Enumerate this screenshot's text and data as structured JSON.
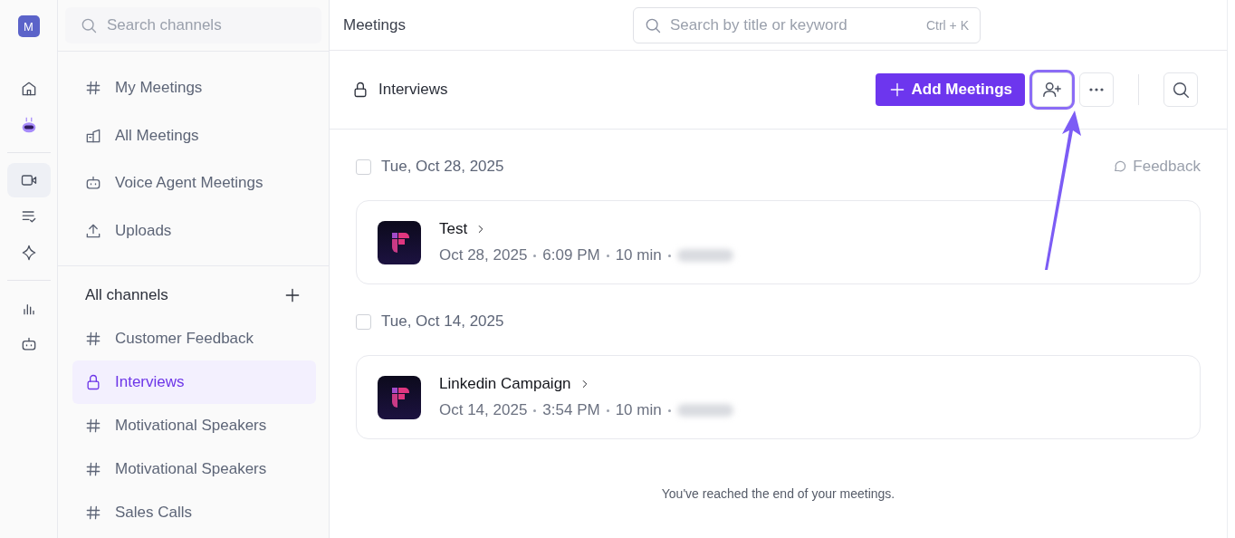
{
  "rail": {
    "avatar": "M",
    "items": [
      {
        "selected": false
      },
      {
        "selected": false
      },
      {
        "selected": true
      },
      {
        "selected": false
      },
      {
        "selected": false
      },
      {
        "selected": false
      },
      {
        "selected": false
      }
    ]
  },
  "sidebar": {
    "search": {
      "placeholder": "Search channels"
    },
    "nav": [
      {
        "label": "My Meetings"
      },
      {
        "label": "All Meetings"
      },
      {
        "label": "Voice Agent Meetings"
      },
      {
        "label": "Uploads"
      }
    ],
    "channels_title": "All channels",
    "channels": [
      {
        "label": "Customer Feedback",
        "private": false,
        "selected": false
      },
      {
        "label": "Interviews",
        "private": true,
        "selected": true
      },
      {
        "label": "Motivational Speakers",
        "private": false,
        "selected": false
      },
      {
        "label": "Motivational Speakers",
        "private": false,
        "selected": false
      },
      {
        "label": "Sales Calls",
        "private": false,
        "selected": false
      }
    ]
  },
  "topbar": {
    "title": "Meetings",
    "search": {
      "placeholder": "Search by title or keyword",
      "shortcut": "Ctrl + K"
    }
  },
  "header": {
    "title": "Interviews",
    "private": true,
    "add_button": "Add Meetings",
    "invite_highlighted": true
  },
  "groups": [
    {
      "date": "Tue, Oct 28, 2025",
      "checked": false,
      "feedback": "Feedback",
      "meetings": [
        {
          "title": "Test",
          "date": "Oct 28, 2025",
          "time": "6:09 PM",
          "duration": "10 min"
        }
      ]
    },
    {
      "date": "Tue, Oct 14, 2025",
      "checked": false,
      "meetings": [
        {
          "title": "Linkedin Campaign",
          "date": "Oct 14, 2025",
          "time": "3:54 PM",
          "duration": "10 min"
        }
      ]
    }
  ],
  "footer": "You've reached the end of your meetings."
}
